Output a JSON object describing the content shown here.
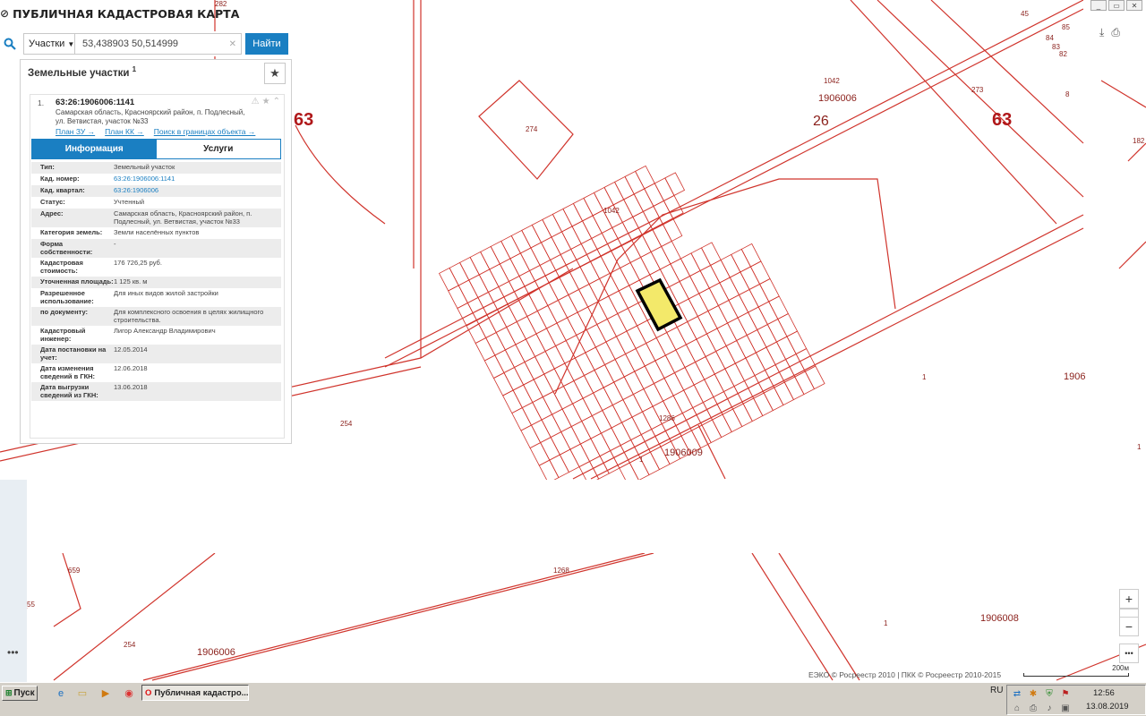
{
  "app": {
    "logo_icon": "⊘",
    "title": "ПУБЛИЧНАЯ КАДАСТРОВАЯ КАРТА"
  },
  "search": {
    "type_label": "Участки",
    "query": "53,438903 50,514999",
    "button_label": "Найти"
  },
  "panel": {
    "title": "Земельные участки",
    "count": "1",
    "fav_icon": "★"
  },
  "card": {
    "num": "1.",
    "cad_number": "63:26:1906006:1141",
    "address": "Самарская область, Красноярский район, п. Подлесный, ул. Ветвистая, участок №33",
    "links": [
      "План ЗУ →",
      "План КК →",
      "Поиск в границах объекта →"
    ],
    "tab_info": "Информация",
    "tab_services": "Услуги",
    "rows": [
      {
        "label": "Тип:",
        "value": "Земельный участок"
      },
      {
        "label": "Кад. номер:",
        "value": "63:26:1906006:1141"
      },
      {
        "label": "Кад. квартал:",
        "value": "63:26:1906006"
      },
      {
        "label": "Статус:",
        "value": "Учтенный"
      },
      {
        "label": "Адрес:",
        "value": "Самарская область, Красноярский район, п. Подлесный, ул. Ветвистая, участок №33"
      },
      {
        "label": "Категория земель:",
        "value": "Земли населённых пунктов"
      },
      {
        "label": "Форма собственности:",
        "value": "-"
      },
      {
        "label": "Кадастровая стоимость:",
        "value": "176 726,25 руб."
      },
      {
        "label": "Уточненная площадь:",
        "value": "1 125 кв. м"
      },
      {
        "label": "Разрешенное использование:",
        "value": "Для иных видов жилой застройки"
      },
      {
        "label": "по документу:",
        "value": "Для комплексного освоения в целях жилищного строительства."
      },
      {
        "label": "Кадастровый инженер:",
        "value": "Лигор Александр Владимирович"
      },
      {
        "label": "Дата постановки на учет:",
        "value": "12.05.2014"
      },
      {
        "label": "Дата изменения сведений в ГКН:",
        "value": "12.06.2018"
      },
      {
        "label": "Дата выгрузки сведений из ГКН:",
        "value": "13.06.2018"
      }
    ]
  },
  "map": {
    "labels": [
      "63",
      "26",
      "63",
      "1042",
      "1906006",
      "274",
      "273",
      "282",
      "45",
      "84",
      "83",
      "82",
      "85",
      "8",
      "182",
      "1042",
      "254",
      "1",
      "1906009",
      "1",
      "1906",
      "1286",
      "1906006",
      "254",
      "1906008",
      "1",
      "659",
      "55",
      "1268",
      "1"
    ],
    "zoom_in": "+",
    "zoom_out": "−",
    "more": "•••",
    "attribution": "ЕЭКО © Росреестр 2010 | ПКК © Росреестр 2010-2015",
    "scale": "200м",
    "line_color": "#d0342c",
    "highlight_color": "#f3e96a"
  },
  "taskbar": {
    "start": "Пуск",
    "task": "Публичная кадастро...",
    "lang": "RU",
    "time": "12:56",
    "date": "13.08.2019"
  }
}
